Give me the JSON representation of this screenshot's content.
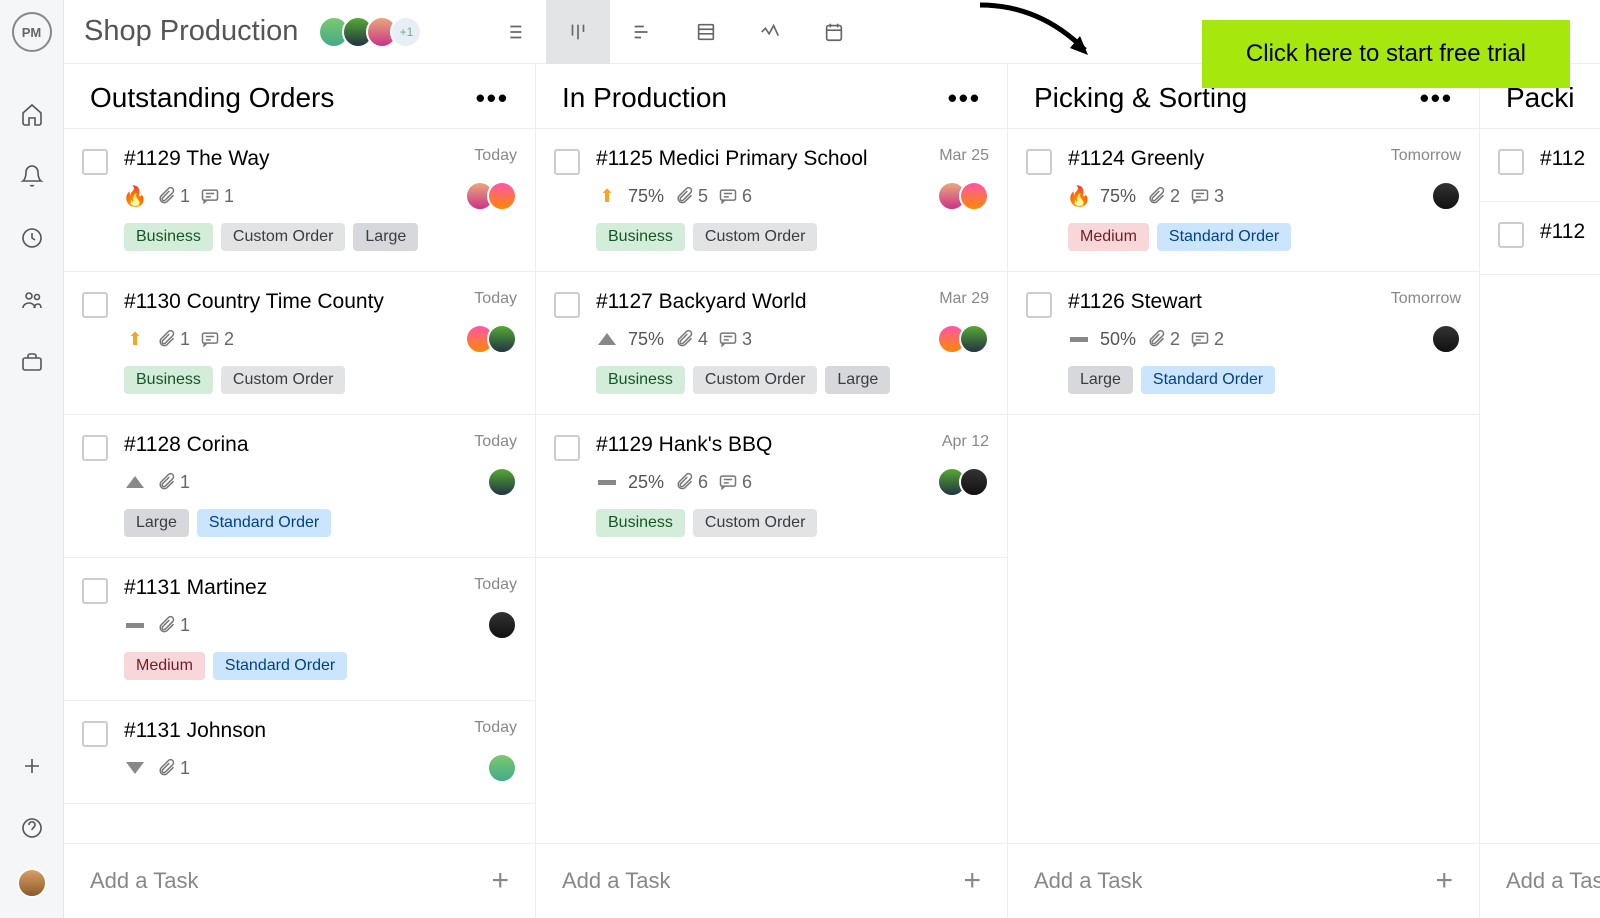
{
  "sidebar": {
    "logo": "PM"
  },
  "project": {
    "title": "Shop Production",
    "more_members": "+1"
  },
  "cta": "Click here to start free trial",
  "add_task_label": "Add a Task",
  "columns": [
    {
      "title": "Outstanding Orders",
      "cards": [
        {
          "title": "#1129 The Way",
          "date": "Today",
          "priority": "flame",
          "percent": null,
          "attach": 1,
          "comments": 1,
          "tags": [
            "Business",
            "Custom Order",
            "Large"
          ],
          "assignees": 2
        },
        {
          "title": "#1130 Country Time County",
          "date": "Today",
          "priority": "arrow-up",
          "percent": null,
          "attach": 1,
          "comments": 2,
          "tags": [
            "Business",
            "Custom Order"
          ],
          "assignees": 2
        },
        {
          "title": "#1128 Corina",
          "date": "Today",
          "priority": "tri-up",
          "percent": null,
          "attach": 1,
          "comments": null,
          "tags": [
            "Large",
            "Standard Order"
          ],
          "assignees": 1
        },
        {
          "title": "#1131 Martinez",
          "date": "Today",
          "priority": "dash",
          "percent": null,
          "attach": 1,
          "comments": null,
          "tags": [
            "Medium",
            "Standard Order"
          ],
          "assignees": 1
        },
        {
          "title": "#1131 Johnson",
          "date": "Today",
          "priority": "tri-down",
          "percent": null,
          "attach": 1,
          "comments": null,
          "tags": [],
          "assignees": 1
        }
      ]
    },
    {
      "title": "In Production",
      "cards": [
        {
          "title": "#1125 Medici Primary School",
          "date": "Mar 25",
          "priority": "arrow-up",
          "percent": "75%",
          "attach": 5,
          "comments": 6,
          "tags": [
            "Business",
            "Custom Order"
          ],
          "assignees": 2
        },
        {
          "title": "#1127 Backyard World",
          "date": "Mar 29",
          "priority": "tri-up",
          "percent": "75%",
          "attach": 4,
          "comments": 3,
          "tags": [
            "Business",
            "Custom Order",
            "Large"
          ],
          "assignees": 2
        },
        {
          "title": "#1129 Hank's BBQ",
          "date": "Apr 12",
          "priority": "dash",
          "percent": "25%",
          "attach": 6,
          "comments": 6,
          "tags": [
            "Business",
            "Custom Order"
          ],
          "assignees": 2
        }
      ]
    },
    {
      "title": "Picking & Sorting",
      "cards": [
        {
          "title": "#1124 Greenly",
          "date": "Tomorrow",
          "priority": "flame",
          "percent": "75%",
          "attach": 2,
          "comments": 3,
          "tags": [
            "Medium",
            "Standard Order"
          ],
          "assignees": 1
        },
        {
          "title": "#1126 Stewart",
          "date": "Tomorrow",
          "priority": "dash",
          "percent": "50%",
          "attach": 2,
          "comments": 2,
          "tags": [
            "Large",
            "Standard Order"
          ],
          "assignees": 1
        }
      ]
    },
    {
      "title": "Packi",
      "cards": [
        {
          "title": "#112",
          "date": "",
          "priority": null,
          "percent": null,
          "attach": null,
          "comments": null,
          "tags": [],
          "assignees": 0
        },
        {
          "title": "#112",
          "date": "",
          "priority": null,
          "percent": null,
          "attach": null,
          "comments": null,
          "tags": [],
          "assignees": 0
        }
      ]
    }
  ]
}
